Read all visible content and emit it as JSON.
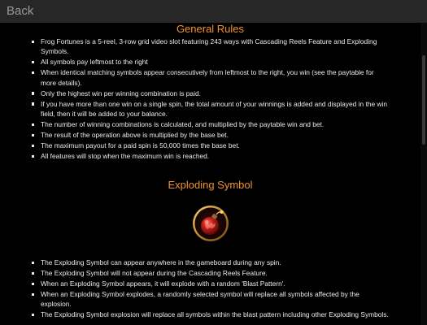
{
  "nav": {
    "back_label": "Back"
  },
  "general": {
    "title": "General Rules",
    "items": [
      "Frog Fortunes is a 5-reel, 3-row grid video slot featuring 243 ways with Cascading Reels Feature and Exploding Symbols.",
      "All symbols pay leftmost to the right",
      "When identical matching symbols appear consecutively from leftmost to the right, you win (see the paytable for more details).",
      "Only the highest win per winning combination is paid.",
      "If you have more than one win on a single spin, the total amount of your winnings is added and displayed in the win field, then it will be added to your balance.",
      "The number of winning combinations is calculated, and multiplied by the paytable win and bet.",
      "The result of the operation above is multiplied by the base bet.",
      "The maximum payout for a paid spin is 50,000 times the base bet.",
      "All features will stop when the maximum win is reached."
    ]
  },
  "exploding": {
    "title": "Exploding Symbol",
    "items": [
      "The Exploding Symbol can appear anywhere in the gameboard during any spin.",
      "The Exploding Symbol will not appear during the Cascading Reels Feature.",
      "When an Exploding Symbol appears, it will explode with a random 'Blast Pattern'.",
      "When an Exploding Symbol explodes, a randomly selected symbol will replace all symbols affected by the explosion.",
      "The Exploding Symbol explosion will replace all symbols within the blast pattern including other Exploding Symbols."
    ]
  },
  "colors": {
    "background": "#000000",
    "heading": "#f0912c",
    "text": "#ececec",
    "topbar": "#272727"
  },
  "icons": {
    "exploding_symbol": "red-bomb-icon"
  }
}
